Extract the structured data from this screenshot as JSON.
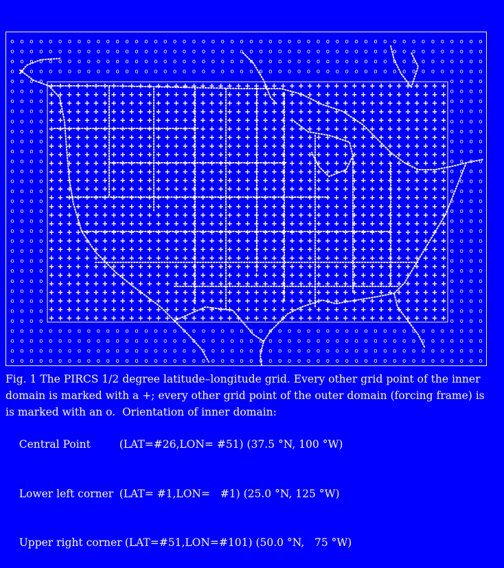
{
  "colors": {
    "background": "#0000ff",
    "foreground": "#ffffff"
  },
  "map": {
    "inner_marker": "+",
    "outer_marker": "o",
    "inner_grid": {
      "lat_count": 51,
      "lon_count": 101,
      "lat_range": [
        25.0,
        50.0
      ],
      "lon_range": [
        -125,
        -75
      ],
      "marked_every": 2
    },
    "outer_grid": {
      "marked_every": 2
    }
  },
  "caption": {
    "line1": "Fig. 1 The PIRCS 1/2 degree latitude–longitude grid. Every other grid point of the inner",
    "line2": "domain is marked with a +; every other grid point of the outer domain (forcing frame) is",
    "line3": "is marked with an o.  Orientation of inner domain:",
    "rows": [
      {
        "label": "Central Point",
        "value": "(LAT=#26,LON= #51) (37.5 °N, 100 °W)"
      },
      {
        "label": "Lower left corner",
        "value": "(LAT= #1,LON=   #1) (25.0 °N, 125 °W)"
      },
      {
        "label": "Upper right corner",
        "value": "(LAT=#51,LON=#101) (50.0 °N,   75 °W)"
      }
    ]
  }
}
